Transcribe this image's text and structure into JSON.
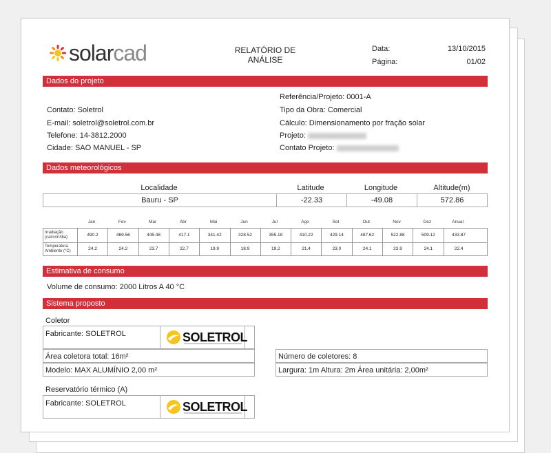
{
  "brand": {
    "name_part1": "solar",
    "name_part2": "cad"
  },
  "report": {
    "title_line1": "RELATÓRIO DE",
    "title_line2": "ANÁLISE",
    "date_label": "Data:",
    "date_value": "13/10/2015",
    "page_label": "Página:",
    "page_value": "01/02"
  },
  "sections": {
    "project": "Dados do projeto",
    "meteo": "Dados meteorológicos",
    "consumption": "Estimativa de consumo",
    "system": "Sistema proposto"
  },
  "project": {
    "reference": "Referência/Projeto: 0001-A",
    "contact": "Contato: Soletrol",
    "work_type": "Tipo da Obra: Comercial",
    "email": "E-mail: soletrol@soletrol.com.br",
    "calculation": "Cálculo: Dimensionamento por fração solar",
    "phone": "Telefone: 14-3812.2000",
    "project_label": "Projeto:",
    "city": "Cidade: SAO MANUEL - SP",
    "project_contact_label": "Contato Projeto:"
  },
  "location": {
    "headers": {
      "locality": "Localidade",
      "latitude": "Latitude",
      "longitude": "Longitude",
      "altitude": "Altitude(m)"
    },
    "values": {
      "locality": "Bauru - SP",
      "latitude": "-22.33",
      "longitude": "-49.08",
      "altitude": "572.86"
    }
  },
  "meteo_table": {
    "months": [
      "Jan",
      "Fev",
      "Mar",
      "Abr",
      "Mai",
      "Jun",
      "Jul",
      "Ago",
      "Set",
      "Out",
      "Nov",
      "Dez",
      "Anual"
    ],
    "irradiation_label_1": "Irradiação",
    "irradiation_label_2": "(cal/cm²/dia)",
    "irradiation": [
      "490.2",
      "469.56",
      "445.48",
      "417.1",
      "341.42",
      "328.52",
      "355.18",
      "410.22",
      "429.14",
      "487.62",
      "522.88",
      "509.12",
      "433.87"
    ],
    "temperature_label_1": "Temperatura",
    "temperature_label_2": "Ambiente (°C)",
    "temperature": [
      "24.2",
      "24.2",
      "23.7",
      "22.7",
      "19.9",
      "18.9",
      "19.2",
      "21.4",
      "23.0",
      "24.1",
      "23.9",
      "24.1",
      "22.4"
    ]
  },
  "consumption": {
    "volume": "Volume de consumo: 2000 Litros A 40 °C"
  },
  "system": {
    "collector_title": "Coletor",
    "collector_manufacturer": "Fabricante: SOLETROL",
    "collector_area": "Área coletora total: 16m²",
    "collector_count": "Número de coletores: 8",
    "collector_model": "Modelo: MAX ALUMÍNIO 2,00 m²",
    "collector_dims": "Largura: 1m Altura: 2m Área unitária: 2,00m²",
    "reservoir_title": "Reservatório térmico (A)",
    "reservoir_manufacturer": "Fabricante: SOLETROL",
    "supplier_logo_text": "SOLETROL"
  },
  "colors": {
    "accent": "#d1303a",
    "sun_orange": "#f28c1c",
    "sun_yellow": "#f6c51b",
    "sun_red": "#d8302f"
  }
}
